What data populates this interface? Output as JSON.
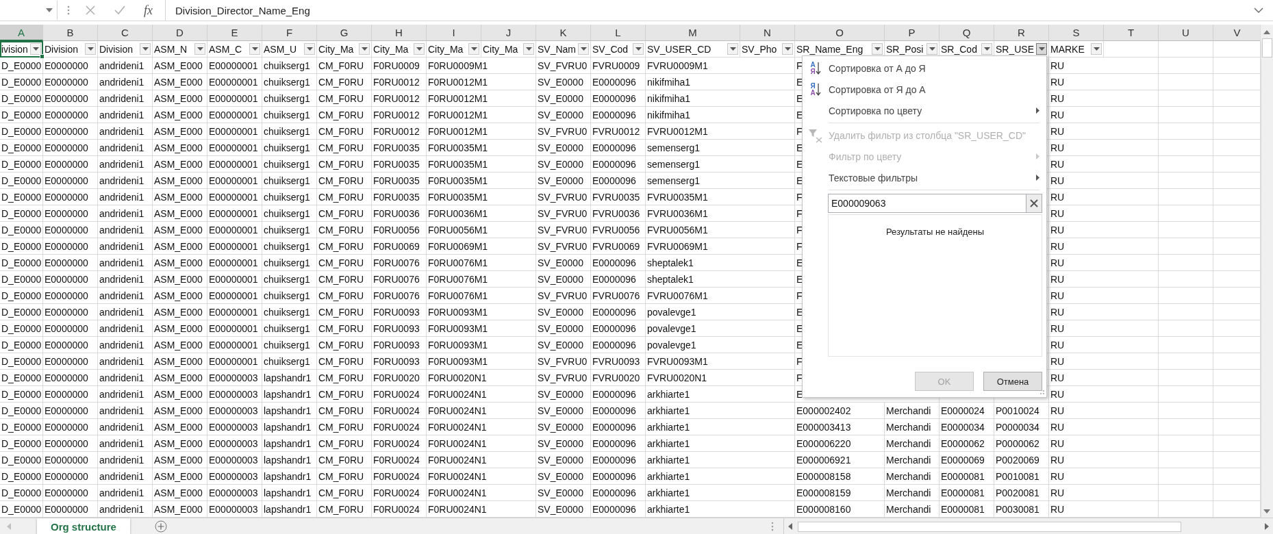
{
  "formula_bar": {
    "function_label": "fx",
    "formula": "Division_Director_Name_Eng"
  },
  "columns": [
    {
      "letter": "A",
      "selected": true
    },
    {
      "letter": "B",
      "selected": false
    },
    {
      "letter": "C",
      "selected": false
    },
    {
      "letter": "D",
      "selected": false
    },
    {
      "letter": "E",
      "selected": false
    },
    {
      "letter": "F",
      "selected": false
    },
    {
      "letter": "G",
      "selected": false
    },
    {
      "letter": "H",
      "selected": false
    },
    {
      "letter": "I",
      "selected": false
    },
    {
      "letter": "J",
      "selected": false
    },
    {
      "letter": "K",
      "selected": false
    },
    {
      "letter": "L",
      "selected": false
    },
    {
      "letter": "M",
      "selected": false
    },
    {
      "letter": "N",
      "selected": false
    },
    {
      "letter": "O",
      "selected": false
    },
    {
      "letter": "P",
      "selected": false
    },
    {
      "letter": "Q",
      "selected": false
    },
    {
      "letter": "R",
      "selected": false
    },
    {
      "letter": "S",
      "selected": false
    },
    {
      "letter": "T",
      "selected": false
    },
    {
      "letter": "U",
      "selected": false
    },
    {
      "letter": "V",
      "selected": false
    }
  ],
  "header_row": [
    {
      "text": "ivision",
      "filter_open": false
    },
    {
      "text": "Division",
      "filter_open": false
    },
    {
      "text": "Division",
      "filter_open": false
    },
    {
      "text": "ASM_N",
      "filter_open": false
    },
    {
      "text": "ASM_C",
      "filter_open": false
    },
    {
      "text": "ASM_U",
      "filter_open": false
    },
    {
      "text": "City_Ma",
      "filter_open": false
    },
    {
      "text": "City_Ma",
      "filter_open": false
    },
    {
      "text": "City_Ma",
      "filter_open": false
    },
    {
      "text": "City_Ma",
      "filter_open": false
    },
    {
      "text": "SV_Nam",
      "filter_open": false
    },
    {
      "text": "SV_Cod",
      "filter_open": false
    },
    {
      "text": "SV_USER_CD",
      "filter_open": false
    },
    {
      "text": "SV_Pho",
      "filter_open": false
    },
    {
      "text": "SR_Name_Eng",
      "filter_open": false
    },
    {
      "text": "SR_Posi",
      "filter_open": false
    },
    {
      "text": "SR_Cod",
      "filter_open": false
    },
    {
      "text": "SR_USE",
      "filter_open": true
    },
    {
      "text": "MARKE",
      "filter_open": false
    }
  ],
  "rows": [
    {
      "A": "D_E0000",
      "B": "E0000000",
      "C": "andrideni1",
      "D": "ASM_E000",
      "E": "E00000001",
      "F": "chuikserg1",
      "G": "CM_F0RU",
      "H": "F0RU0009",
      "I": "F0RU0009M1",
      "K": "SV_FVRU0",
      "L": "FVRU0009",
      "M": "FVRU0009M1",
      "O": "F",
      "S": "RU"
    },
    {
      "A": "D_E0000",
      "B": "E0000000",
      "C": "andrideni1",
      "D": "ASM_E000",
      "E": "E00000001",
      "F": "chuikserg1",
      "G": "CM_F0RU",
      "H": "F0RU0012",
      "I": "F0RU0012M1",
      "K": "SV_E0000",
      "L": "E0000096",
      "M": "nikifmiha1",
      "O": "E",
      "S": "RU"
    },
    {
      "A": "D_E0000",
      "B": "E0000000",
      "C": "andrideni1",
      "D": "ASM_E000",
      "E": "E00000001",
      "F": "chuikserg1",
      "G": "CM_F0RU",
      "H": "F0RU0012",
      "I": "F0RU0012M1",
      "K": "SV_E0000",
      "L": "E0000096",
      "M": "nikifmiha1",
      "O": "E",
      "S": "RU"
    },
    {
      "A": "D_E0000",
      "B": "E0000000",
      "C": "andrideni1",
      "D": "ASM_E000",
      "E": "E00000001",
      "F": "chuikserg1",
      "G": "CM_F0RU",
      "H": "F0RU0012",
      "I": "F0RU0012M1",
      "K": "SV_E0000",
      "L": "E0000096",
      "M": "nikifmiha1",
      "O": "E",
      "S": "RU"
    },
    {
      "A": "D_E0000",
      "B": "E0000000",
      "C": "andrideni1",
      "D": "ASM_E000",
      "E": "E00000001",
      "F": "chuikserg1",
      "G": "CM_F0RU",
      "H": "F0RU0012",
      "I": "F0RU0012M1",
      "K": "SV_FVRU0",
      "L": "FVRU0012",
      "M": "FVRU0012M1",
      "O": "F",
      "S": "RU"
    },
    {
      "A": "D_E0000",
      "B": "E0000000",
      "C": "andrideni1",
      "D": "ASM_E000",
      "E": "E00000001",
      "F": "chuikserg1",
      "G": "CM_F0RU",
      "H": "F0RU0035",
      "I": "F0RU0035M1",
      "K": "SV_E0000",
      "L": "E0000096",
      "M": "semenserg1",
      "O": "E",
      "S": "RU"
    },
    {
      "A": "D_E0000",
      "B": "E0000000",
      "C": "andrideni1",
      "D": "ASM_E000",
      "E": "E00000001",
      "F": "chuikserg1",
      "G": "CM_F0RU",
      "H": "F0RU0035",
      "I": "F0RU0035M1",
      "K": "SV_E0000",
      "L": "E0000096",
      "M": "semenserg1",
      "O": "E",
      "S": "RU"
    },
    {
      "A": "D_E0000",
      "B": "E0000000",
      "C": "andrideni1",
      "D": "ASM_E000",
      "E": "E00000001",
      "F": "chuikserg1",
      "G": "CM_F0RU",
      "H": "F0RU0035",
      "I": "F0RU0035M1",
      "K": "SV_E0000",
      "L": "E0000096",
      "M": "semenserg1",
      "O": "E",
      "S": "RU"
    },
    {
      "A": "D_E0000",
      "B": "E0000000",
      "C": "andrideni1",
      "D": "ASM_E000",
      "E": "E00000001",
      "F": "chuikserg1",
      "G": "CM_F0RU",
      "H": "F0RU0035",
      "I": "F0RU0035M1",
      "K": "SV_FVRU0",
      "L": "FVRU0035",
      "M": "FVRU0035M1",
      "O": "F",
      "S": "RU"
    },
    {
      "A": "D_E0000",
      "B": "E0000000",
      "C": "andrideni1",
      "D": "ASM_E000",
      "E": "E00000001",
      "F": "chuikserg1",
      "G": "CM_F0RU",
      "H": "F0RU0036",
      "I": "F0RU0036M1",
      "K": "SV_FVRU0",
      "L": "FVRU0036",
      "M": "FVRU0036M1",
      "O": "F",
      "S": "RU"
    },
    {
      "A": "D_E0000",
      "B": "E0000000",
      "C": "andrideni1",
      "D": "ASM_E000",
      "E": "E00000001",
      "F": "chuikserg1",
      "G": "CM_F0RU",
      "H": "F0RU0056",
      "I": "F0RU0056M1",
      "K": "SV_FVRU0",
      "L": "FVRU0056",
      "M": "FVRU0056M1",
      "O": "F",
      "S": "RU"
    },
    {
      "A": "D_E0000",
      "B": "E0000000",
      "C": "andrideni1",
      "D": "ASM_E000",
      "E": "E00000001",
      "F": "chuikserg1",
      "G": "CM_F0RU",
      "H": "F0RU0069",
      "I": "F0RU0069M1",
      "K": "SV_FVRU0",
      "L": "FVRU0069",
      "M": "FVRU0069M1",
      "O": "F",
      "S": "RU"
    },
    {
      "A": "D_E0000",
      "B": "E0000000",
      "C": "andrideni1",
      "D": "ASM_E000",
      "E": "E00000001",
      "F": "chuikserg1",
      "G": "CM_F0RU",
      "H": "F0RU0076",
      "I": "F0RU0076M1",
      "K": "SV_E0000",
      "L": "E0000096",
      "M": "sheptalek1",
      "O": "E",
      "S": "RU"
    },
    {
      "A": "D_E0000",
      "B": "E0000000",
      "C": "andrideni1",
      "D": "ASM_E000",
      "E": "E00000001",
      "F": "chuikserg1",
      "G": "CM_F0RU",
      "H": "F0RU0076",
      "I": "F0RU0076M1",
      "K": "SV_E0000",
      "L": "E0000096",
      "M": "sheptalek1",
      "O": "E",
      "S": "RU"
    },
    {
      "A": "D_E0000",
      "B": "E0000000",
      "C": "andrideni1",
      "D": "ASM_E000",
      "E": "E00000001",
      "F": "chuikserg1",
      "G": "CM_F0RU",
      "H": "F0RU0076",
      "I": "F0RU0076M1",
      "K": "SV_FVRU0",
      "L": "FVRU0076",
      "M": "FVRU0076M1",
      "O": "F",
      "S": "RU"
    },
    {
      "A": "D_E0000",
      "B": "E0000000",
      "C": "andrideni1",
      "D": "ASM_E000",
      "E": "E00000001",
      "F": "chuikserg1",
      "G": "CM_F0RU",
      "H": "F0RU0093",
      "I": "F0RU0093M1",
      "K": "SV_E0000",
      "L": "E0000096",
      "M": "povalevge1",
      "O": "E",
      "S": "RU"
    },
    {
      "A": "D_E0000",
      "B": "E0000000",
      "C": "andrideni1",
      "D": "ASM_E000",
      "E": "E00000001",
      "F": "chuikserg1",
      "G": "CM_F0RU",
      "H": "F0RU0093",
      "I": "F0RU0093M1",
      "K": "SV_E0000",
      "L": "E0000096",
      "M": "povalevge1",
      "O": "E",
      "S": "RU"
    },
    {
      "A": "D_E0000",
      "B": "E0000000",
      "C": "andrideni1",
      "D": "ASM_E000",
      "E": "E00000001",
      "F": "chuikserg1",
      "G": "CM_F0RU",
      "H": "F0RU0093",
      "I": "F0RU0093M1",
      "K": "SV_E0000",
      "L": "E0000096",
      "M": "povalevge1",
      "O": "E",
      "S": "RU"
    },
    {
      "A": "D_E0000",
      "B": "E0000000",
      "C": "andrideni1",
      "D": "ASM_E000",
      "E": "E00000001",
      "F": "chuikserg1",
      "G": "CM_F0RU",
      "H": "F0RU0093",
      "I": "F0RU0093M1",
      "K": "SV_FVRU0",
      "L": "FVRU0093",
      "M": "FVRU0093M1",
      "O": "F",
      "S": "RU"
    },
    {
      "A": "D_E0000",
      "B": "E0000000",
      "C": "andrideni1",
      "D": "ASM_E000",
      "E": "E00000003",
      "F": "lapshandr1",
      "G": "CM_F0RU",
      "H": "F0RU0020",
      "I": "F0RU0020N1",
      "K": "SV_FVRU0",
      "L": "FVRU0020",
      "M": "FVRU0020N1",
      "O": "F",
      "S": "RU"
    },
    {
      "A": "D_E0000",
      "B": "E0000000",
      "C": "andrideni1",
      "D": "ASM_E000",
      "E": "E00000003",
      "F": "lapshandr1",
      "G": "CM_F0RU",
      "H": "F0RU0024",
      "I": "F0RU0024N1",
      "K": "SV_E0000",
      "L": "E0000096",
      "M": "arkhiarte1",
      "O": "E",
      "S": "RU"
    },
    {
      "A": "D_E0000",
      "B": "E0000000",
      "C": "andrideni1",
      "D": "ASM_E000",
      "E": "E00000003",
      "F": "lapshandr1",
      "G": "CM_F0RU",
      "H": "F0RU0024",
      "I": "F0RU0024N1",
      "K": "SV_E0000",
      "L": "E0000096",
      "M": "arkhiarte1",
      "O": "E000002402",
      "P": "Merchandi",
      "Q": "E0000024",
      "R": "P0010024",
      "S": "RU"
    },
    {
      "A": "D_E0000",
      "B": "E0000000",
      "C": "andrideni1",
      "D": "ASM_E000",
      "E": "E00000003",
      "F": "lapshandr1",
      "G": "CM_F0RU",
      "H": "F0RU0024",
      "I": "F0RU0024N1",
      "K": "SV_E0000",
      "L": "E0000096",
      "M": "arkhiarte1",
      "O": "E000003413",
      "P": "Merchandi",
      "Q": "E0000034",
      "R": "P0000034",
      "S": "RU"
    },
    {
      "A": "D_E0000",
      "B": "E0000000",
      "C": "andrideni1",
      "D": "ASM_E000",
      "E": "E00000003",
      "F": "lapshandr1",
      "G": "CM_F0RU",
      "H": "F0RU0024",
      "I": "F0RU0024N1",
      "K": "SV_E0000",
      "L": "E0000096",
      "M": "arkhiarte1",
      "O": "E000006220",
      "P": "Merchandi",
      "Q": "E0000062",
      "R": "P0000062",
      "S": "RU"
    },
    {
      "A": "D_E0000",
      "B": "E0000000",
      "C": "andrideni1",
      "D": "ASM_E000",
      "E": "E00000003",
      "F": "lapshandr1",
      "G": "CM_F0RU",
      "H": "F0RU0024",
      "I": "F0RU0024N1",
      "K": "SV_E0000",
      "L": "E0000096",
      "M": "arkhiarte1",
      "O": "E000006921",
      "P": "Merchandi",
      "Q": "E0000069",
      "R": "P0020069",
      "S": "RU"
    },
    {
      "A": "D_E0000",
      "B": "E0000000",
      "C": "andrideni1",
      "D": "ASM_E000",
      "E": "E00000003",
      "F": "lapshandr1",
      "G": "CM_F0RU",
      "H": "F0RU0024",
      "I": "F0RU0024N1",
      "K": "SV_E0000",
      "L": "E0000096",
      "M": "arkhiarte1",
      "O": "E000008158",
      "P": "Merchandi",
      "Q": "E0000081",
      "R": "P0010081",
      "S": "RU"
    },
    {
      "A": "D_E0000",
      "B": "E0000000",
      "C": "andrideni1",
      "D": "ASM_E000",
      "E": "E00000003",
      "F": "lapshandr1",
      "G": "CM_F0RU",
      "H": "F0RU0024",
      "I": "F0RU0024N1",
      "K": "SV_E0000",
      "L": "E0000096",
      "M": "arkhiarte1",
      "O": "E000008159",
      "P": "Merchandi",
      "Q": "E0000081",
      "R": "P0020081",
      "S": "RU"
    },
    {
      "A": "D_E0000",
      "B": "E0000000",
      "C": "andrideni1",
      "D": "ASM_E000",
      "E": "E00000003",
      "F": "lapshandr1",
      "G": "CM_F0RU",
      "H": "F0RU0024",
      "I": "F0RU0024N1",
      "K": "SV_E0000",
      "L": "E0000096",
      "M": "arkhiarte1",
      "O": "E000008160",
      "P": "Merchandi",
      "Q": "E0000081",
      "R": "P0030081",
      "S": "RU"
    }
  ],
  "filter_menu": {
    "items": [
      {
        "kind": "sort_asc",
        "label": "Сортировка от А до Я",
        "icon_letters": [
          "А",
          "Я"
        ],
        "disabled": false
      },
      {
        "kind": "sort_desc",
        "label": "Сортировка от Я до А",
        "icon_letters": [
          "Я",
          "А"
        ],
        "disabled": false
      },
      {
        "kind": "submenu",
        "label": "Сортировка по цвету",
        "disabled": false
      },
      {
        "kind": "clear_filter",
        "label": "Удалить фильтр из столбца \"SR_USER_CD\"",
        "disabled": true
      },
      {
        "kind": "submenu",
        "label": "Фильтр по цвету",
        "disabled": true
      },
      {
        "kind": "submenu",
        "label": "Текстовые фильтры",
        "disabled": false
      }
    ],
    "search": {
      "value": "E000009063"
    },
    "results_message": "Результаты не найдены",
    "buttons": [
      {
        "label": "OK",
        "disabled": true
      },
      {
        "label": "Отмена",
        "disabled": false
      }
    ]
  },
  "sheet_tabs": [
    {
      "label": "Org structure",
      "selected": true
    }
  ]
}
